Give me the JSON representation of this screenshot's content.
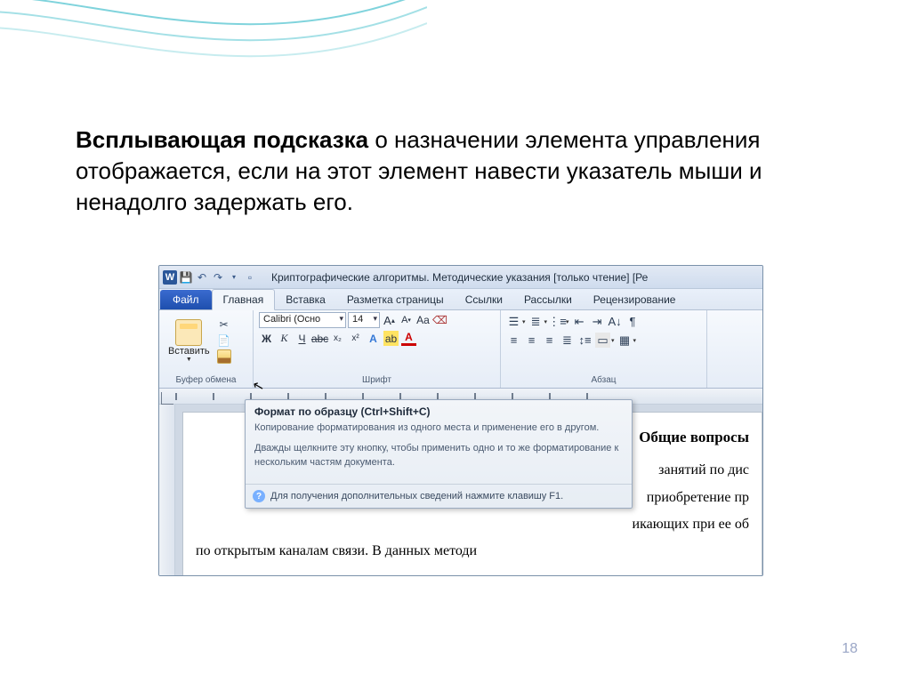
{
  "slide": {
    "text_bold": "Всплывающая подсказка",
    "text_rest": " о назначении элемента управления отображается, если на этот элемент навести указатель мыши и ненадолго задержать его.",
    "page_number": "18"
  },
  "word": {
    "title": "Криптографические алгоритмы. Методические указания [только чтение] [Ре",
    "tabs": {
      "file": "Файл",
      "items": [
        "Главная",
        "Вставка",
        "Разметка страницы",
        "Ссылки",
        "Рассылки",
        "Рецензирование"
      ],
      "active": 0
    },
    "clipboard": {
      "paste": "Вставить",
      "group_label": "Буфер обмена"
    },
    "font": {
      "name": "Calibri (Осно",
      "size": "14",
      "group_label": "Шрифт"
    },
    "paragraph": {
      "group_label": "Абзац"
    },
    "tooltip": {
      "title": "Формат по образцу (Ctrl+Shift+C)",
      "line1": "Копирование форматирования из одного места и применение его в другом.",
      "line2": "Дважды щелкните эту кнопку, чтобы применить одно и то же форматирование к нескольким частям документа.",
      "footer": "Для получения дополнительных сведений нажмите клавишу F1."
    },
    "document": {
      "heading": "Общие вопросы",
      "l1": "занятий по дис",
      "l2": "приобретение пр",
      "l3": "икающих при ее об",
      "l4": "по открытым каналам связи. В данных методи"
    }
  }
}
